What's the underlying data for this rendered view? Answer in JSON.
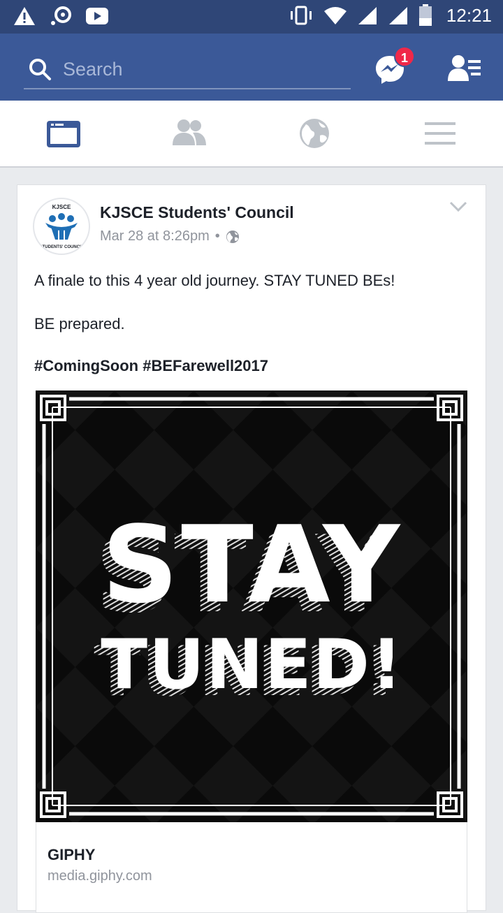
{
  "status_bar": {
    "time": "12:21",
    "icons": [
      "warning-icon",
      "sync-icon",
      "youtube-icon",
      "vibrate-icon",
      "wifi-icon",
      "signal-icon",
      "signal-icon",
      "battery-icon"
    ]
  },
  "header": {
    "search_placeholder": "Search",
    "messenger_badge": "1",
    "brand_color": "#3b5998"
  },
  "tabs": [
    {
      "name": "news-feed",
      "icon": "news-feed-icon",
      "active": true
    },
    {
      "name": "friends",
      "icon": "friends-icon",
      "active": false
    },
    {
      "name": "notifications",
      "icon": "globe-icon",
      "active": false
    },
    {
      "name": "menu",
      "icon": "menu-icon",
      "active": false
    }
  ],
  "post": {
    "author": "KJSCE Students' Council",
    "avatar_text_top": "KJSCE",
    "avatar_text_bottom": "STUDENTS' COUNCIL",
    "timestamp": "Mar 28 at 8:26pm",
    "separator": "•",
    "privacy_icon": "globe-icon",
    "paragraphs": [
      "A finale to this 4 year old journey. STAY TUNED BEs!",
      "BE prepared."
    ],
    "hashtags": "#ComingSoon #BEFarewell2017",
    "gif_text_line1": "STAY",
    "gif_text_line2": "TUNED!",
    "link_title": "GIPHY",
    "link_url": "media.giphy.com"
  }
}
